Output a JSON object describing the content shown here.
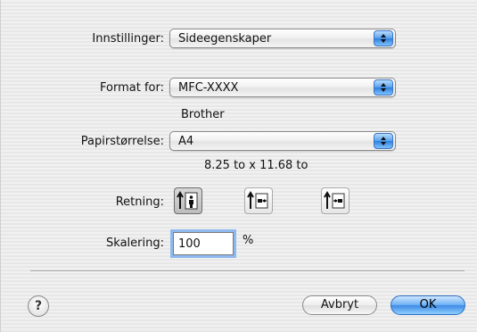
{
  "settings": {
    "label": "Innstillinger:",
    "value": "Sideegenskaper"
  },
  "format_for": {
    "label": "Format for:",
    "value": "MFC-XXXX",
    "vendor": "Brother"
  },
  "paper_size": {
    "label": "Papirstørrelse:",
    "value": "A4",
    "dimensions": "8.25 to x 11.68 to"
  },
  "orientation": {
    "label": "Retning:",
    "options": [
      {
        "icon": "portrait-orientation-icon",
        "selected": true
      },
      {
        "icon": "landscape-left-orientation-icon",
        "selected": false
      },
      {
        "icon": "landscape-right-orientation-icon",
        "selected": false
      }
    ]
  },
  "scale": {
    "label": "Skalering:",
    "value": "100",
    "unit": "%"
  },
  "buttons": {
    "help": "?",
    "cancel": "Avbryt",
    "ok": "OK"
  },
  "colors": {
    "accent": "#3f8ae4"
  }
}
